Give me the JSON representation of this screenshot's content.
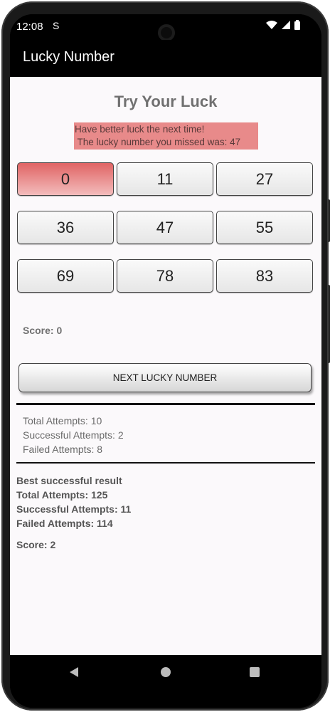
{
  "status": {
    "time": "12:08",
    "notification_icon": "S"
  },
  "app": {
    "title": "Lucky Number"
  },
  "main": {
    "heading": "Try Your Luck",
    "message_line1": "Have better luck the next time!",
    "message_line2": " The lucky number you missed was: 47",
    "numbers": [
      "0",
      "11",
      "27",
      "36",
      "47",
      "55",
      "69",
      "78",
      "83"
    ],
    "selected_index": 0,
    "current_score": "Score: 0",
    "next_button": "NEXT LUCKY NUMBER",
    "stats": {
      "total": "Total Attempts: 10",
      "successful": "Successful Attempts: 2",
      "failed": "Failed Attempts:  8"
    },
    "best": {
      "title": "Best successful result",
      "total": "Total Attempts: 125",
      "successful": "Successful Attempts: 11",
      "failed": "Failed Attempts:  114",
      "score": "Score: 2"
    }
  },
  "colors": {
    "selected_button": "#e06464",
    "message_bg": "#e88a8a",
    "app_bar": "#000000"
  },
  "icons": [
    "wifi-icon",
    "signal-icon",
    "battery-icon",
    "back-icon",
    "home-icon",
    "recents-icon"
  ]
}
